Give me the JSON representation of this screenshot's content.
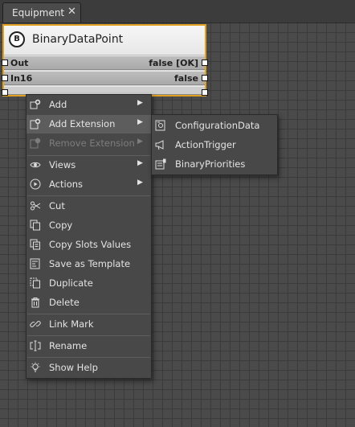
{
  "tab": {
    "label": "Equipment",
    "close": "✕"
  },
  "component": {
    "icon_letter": "B",
    "title": "BinaryDataPoint",
    "slots": [
      {
        "name": "Out",
        "value": "false [OK]"
      },
      {
        "name": "In16",
        "value": "false"
      }
    ]
  },
  "menu": {
    "items": [
      {
        "label": "Add",
        "icon": "add-icon",
        "submenu": true
      },
      {
        "label": "Add Extension",
        "icon": "add-extension-icon",
        "submenu": true,
        "highlighted": true
      },
      {
        "label": "Remove Extension",
        "icon": "remove-extension-icon",
        "submenu": true,
        "disabled": true
      },
      {
        "label": "Views",
        "icon": "eye-icon",
        "submenu": true
      },
      {
        "label": "Actions",
        "icon": "play-icon",
        "submenu": true
      },
      {
        "label": "Cut",
        "icon": "scissors-icon"
      },
      {
        "label": "Copy",
        "icon": "copy-icon"
      },
      {
        "label": "Copy Slots Values",
        "icon": "copy-slots-icon"
      },
      {
        "label": "Save as Template",
        "icon": "template-icon"
      },
      {
        "label": "Duplicate",
        "icon": "duplicate-icon"
      },
      {
        "label": "Delete",
        "icon": "trash-icon"
      },
      {
        "label": "Link Mark",
        "icon": "link-icon"
      },
      {
        "label": "Rename",
        "icon": "rename-icon"
      },
      {
        "label": "Show Help",
        "icon": "lightbulb-icon"
      }
    ]
  },
  "submenu": {
    "items": [
      {
        "label": "ConfigurationData",
        "icon": "configuration-data-icon"
      },
      {
        "label": "ActionTrigger",
        "icon": "megaphone-icon"
      },
      {
        "label": "BinaryPriorities",
        "icon": "priorities-icon"
      }
    ]
  },
  "colors": {
    "selection_border": "#e0a020",
    "menu_bg": "#484848",
    "highlight": "#5d5d5d"
  }
}
